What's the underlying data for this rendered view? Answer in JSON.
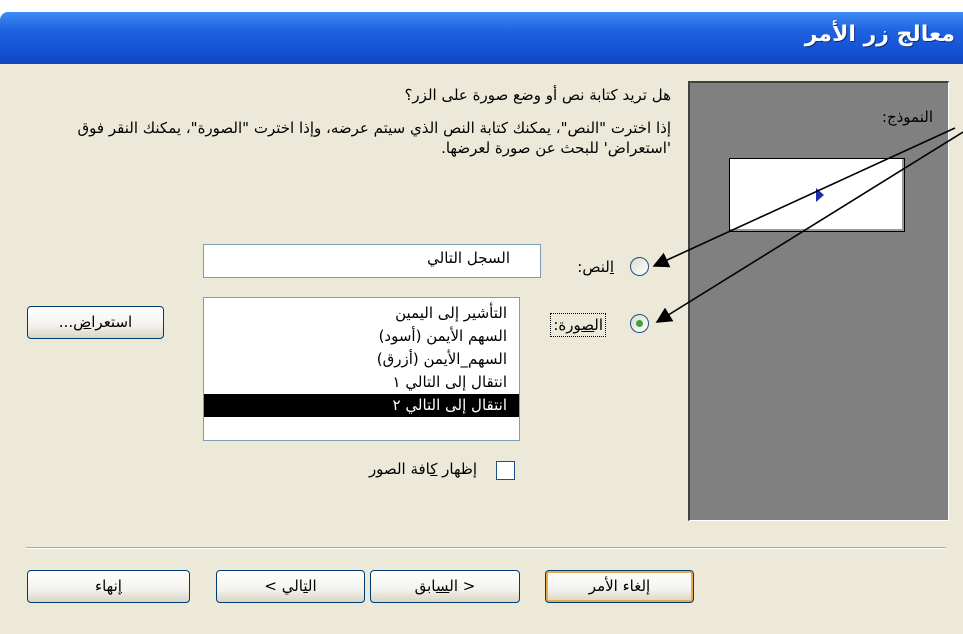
{
  "window": {
    "title": "معالج زر الأمر"
  },
  "main": {
    "question": "هل تريد كتابة نص أو وضع صورة على الزر؟",
    "description": "إذا اخترت \"النص\"، يمكنك كتابة النص الذي سيتم عرضه، وإذا اخترت \"الصورة\"، يمكنك النقر فوق 'استعراض' للبحث عن صورة لعرضها."
  },
  "sample": {
    "label": "النموذج:"
  },
  "options": {
    "text_label_hotkey": "ا",
    "text_label_rest": "لنص:",
    "text_value": "السجل التالي",
    "picture_label_pre": "ال",
    "picture_label_hotkey": "ص",
    "picture_label_rest": "ورة:",
    "selected": "picture"
  },
  "picture_list": {
    "items": [
      "التأشير إلى اليمين",
      "السهم الأيمن (أسود)",
      "السهم_الأيمن (أزرق)",
      "انتقال إلى التالي ١",
      "انتقال إلى التالي ٢"
    ],
    "selected_index": 4
  },
  "browse_button": {
    "label_pre": "استعرا",
    "label_hotkey": "ض",
    "label_post": "..."
  },
  "show_all": {
    "label_pre": "إظهار ",
    "label_hotkey": "ك",
    "label_rest": "افة الصور",
    "checked": false
  },
  "footer": {
    "cancel": "إلغاء الأمر",
    "back_pre": "< ال",
    "back_hotkey": "س",
    "back_rest": "ابق",
    "next_pre": "ال",
    "next_hotkey": "ت",
    "next_rest": "الي >",
    "finish_hotkey": "إ",
    "finish_rest": "نهاء"
  },
  "colors": {
    "titlebar": "#1553d6",
    "panel": "#808080",
    "face": "#ece9d8",
    "default_button_ring": "#e8a94c",
    "radio_dot": "#3ba43b"
  }
}
